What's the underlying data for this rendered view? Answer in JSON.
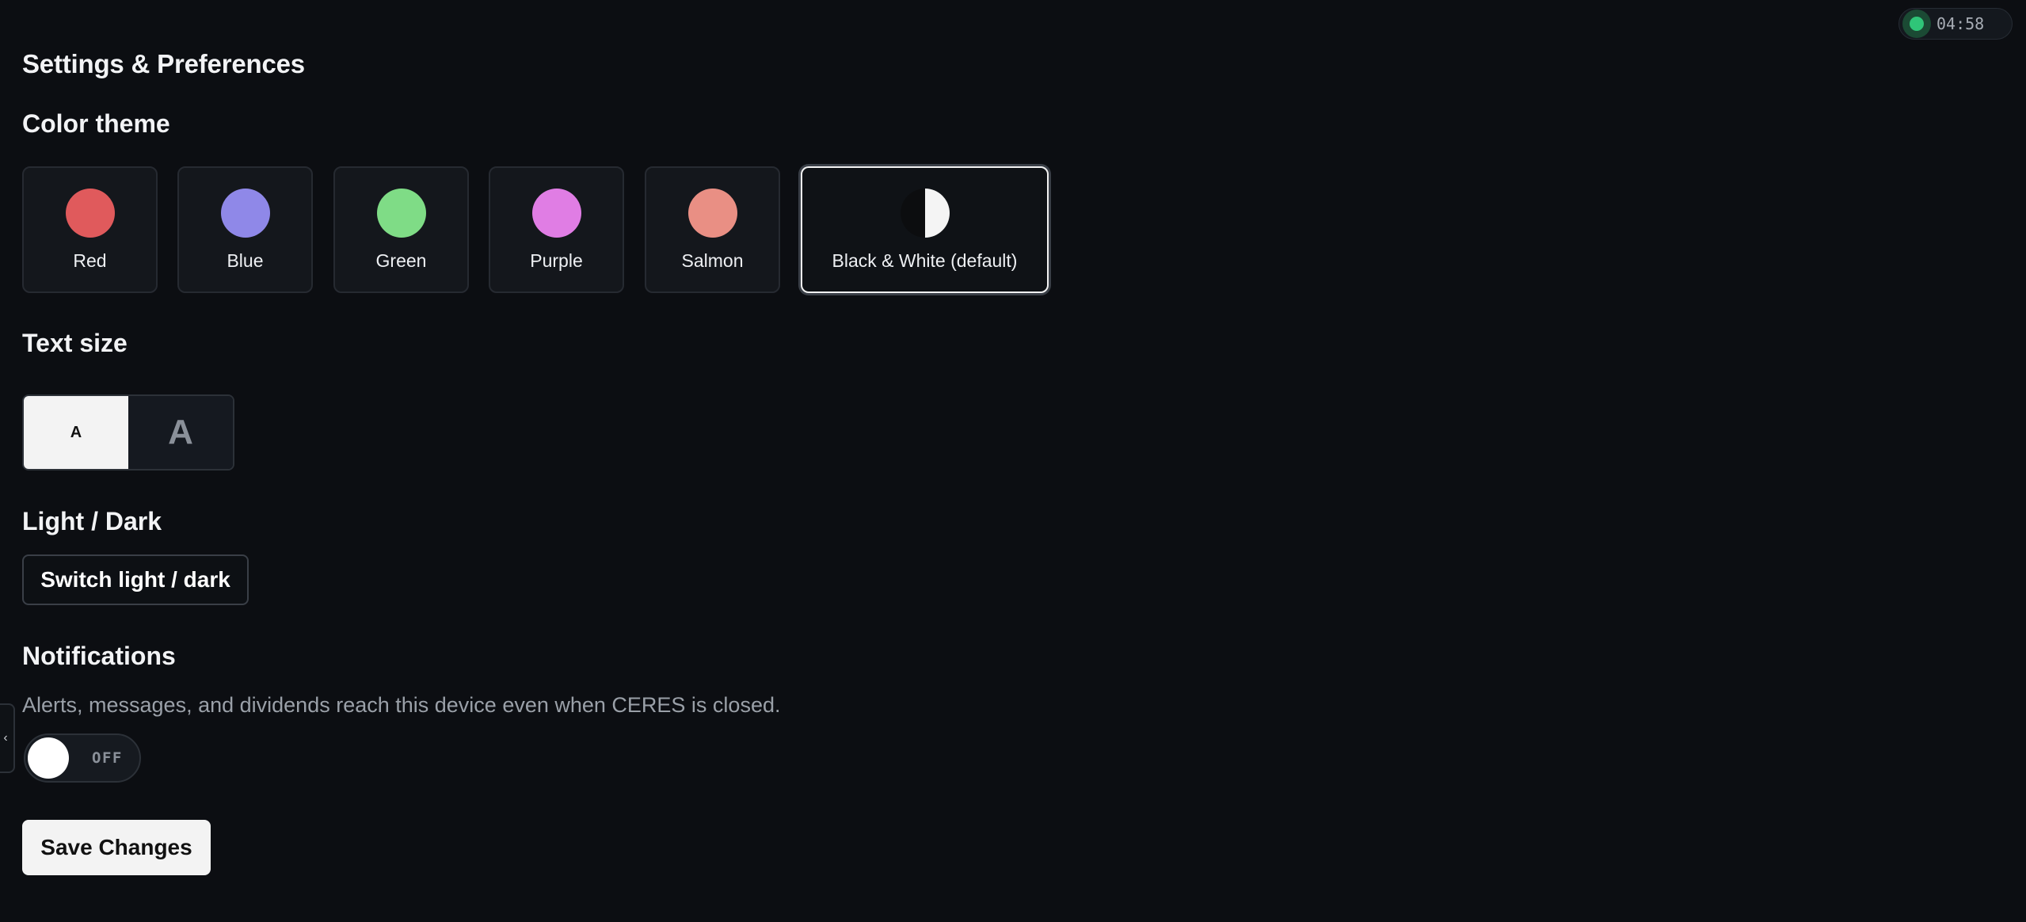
{
  "timer": {
    "time": "04:58",
    "status_color": "#2fc578"
  },
  "page": {
    "title": "Settings & Preferences"
  },
  "color_theme": {
    "heading": "Color theme",
    "options": [
      {
        "label": "Red",
        "color": "#e05a5c",
        "selected": false
      },
      {
        "label": "Blue",
        "color": "#8f88e8",
        "selected": false
      },
      {
        "label": "Green",
        "color": "#7fdc86",
        "selected": false
      },
      {
        "label": "Purple",
        "color": "#e07de4",
        "selected": false
      },
      {
        "label": "Salmon",
        "color": "#e98f84",
        "selected": false
      },
      {
        "label": "Black & White (default)",
        "color": "#f4f4f4",
        "selected": true
      }
    ]
  },
  "text_size": {
    "heading": "Text size",
    "small_label": "A",
    "large_label": "A",
    "selected": "small"
  },
  "light_dark": {
    "heading": "Light / Dark",
    "button_label": "Switch light / dark"
  },
  "notifications": {
    "heading": "Notifications",
    "description": "Alerts, messages, and dividends reach this device even when CERES is closed.",
    "toggle_state": "OFF",
    "enabled": false
  },
  "actions": {
    "save_label": "Save Changes"
  },
  "edge_handle": {
    "glyph": "‹"
  }
}
